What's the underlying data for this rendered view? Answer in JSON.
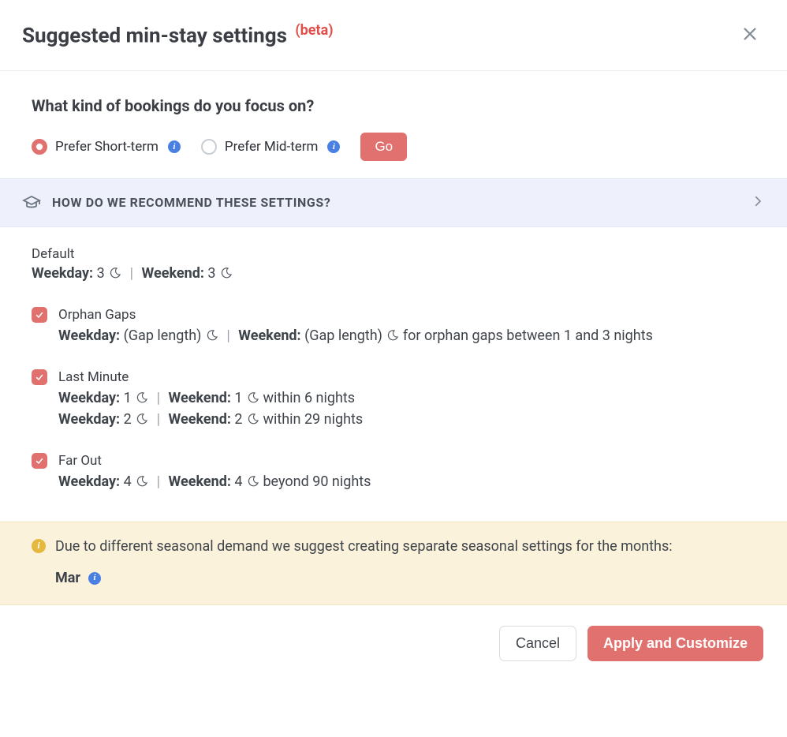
{
  "header": {
    "title": "Suggested min-stay settings",
    "beta": "(beta)"
  },
  "question": {
    "prompt": "What kind of bookings do you focus on?",
    "options": [
      {
        "label": "Prefer Short-term",
        "selected": true
      },
      {
        "label": "Prefer Mid-term",
        "selected": false
      }
    ],
    "go_label": "Go"
  },
  "accordion": {
    "title": "HOW DO WE RECOMMEND THESE SETTINGS?"
  },
  "default_group": {
    "name": "Default",
    "weekday_label": "Weekday:",
    "weekend_label": "Weekend:",
    "weekday_value": "3",
    "weekend_value": "3"
  },
  "orphan": {
    "name": "Orphan Gaps",
    "weekday_label": "Weekday:",
    "weekend_label": "Weekend:",
    "weekday_value": "(Gap length)",
    "weekend_value": "(Gap length)",
    "tail": "for orphan gaps between 1 and 3 nights"
  },
  "last_minute": {
    "name": "Last Minute",
    "rules": [
      {
        "weekday_label": "Weekday:",
        "weekday_value": "1",
        "weekend_label": "Weekend:",
        "weekend_value": "1",
        "tail": "within 6 nights"
      },
      {
        "weekday_label": "Weekday:",
        "weekday_value": "2",
        "weekend_label": "Weekend:",
        "weekend_value": "2",
        "tail": "within 29 nights"
      }
    ]
  },
  "far_out": {
    "name": "Far Out",
    "weekday_label": "Weekday:",
    "weekend_label": "Weekend:",
    "weekday_value": "4",
    "weekend_value": "4",
    "tail": "beyond 90 nights"
  },
  "warning": {
    "text": "Due to different seasonal demand we suggest creating separate seasonal settings for the months:",
    "month": "Mar"
  },
  "footer": {
    "cancel": "Cancel",
    "apply": "Apply and Customize"
  }
}
